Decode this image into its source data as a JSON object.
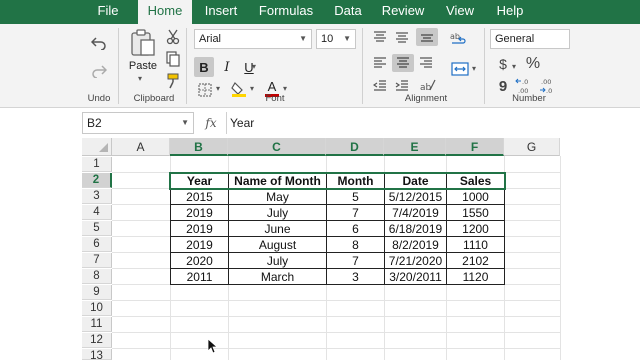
{
  "menu": {
    "tabs": [
      "File",
      "Home",
      "Insert",
      "Formulas",
      "Data",
      "Review",
      "View",
      "Help"
    ],
    "active": "Home"
  },
  "ribbon": {
    "undo_label": "Undo",
    "clipboard_label": "Clipboard",
    "paste_label": "Paste",
    "font_label": "Font",
    "font_name": "Arial",
    "font_size": "10",
    "bold": "B",
    "italic": "I",
    "underline": "U",
    "font_color_glyph": "A",
    "alignment_label": "Alignment",
    "number_label": "Number",
    "number_format": "General",
    "currency_symbol": "$",
    "percent_symbol": "%",
    "comma_symbol": "9",
    "decimal_increase": "←.0\n.00",
    "decimal_decrease": ".00\n→.0",
    "accent_color": "#217346",
    "font_color": "#c00000",
    "fill_color": "#ffd500"
  },
  "formula_bar": {
    "name_box": "B2",
    "fx": "fx",
    "content": "Year"
  },
  "grid": {
    "columns": [
      "A",
      "B",
      "C",
      "D",
      "E",
      "F",
      "G"
    ],
    "rows": [
      "1",
      "2",
      "3",
      "4",
      "5",
      "6",
      "7",
      "8",
      "9",
      "10",
      "11",
      "12",
      "13"
    ],
    "selected_columns": [
      "B",
      "C",
      "D",
      "E",
      "F"
    ],
    "selected_row": "2"
  },
  "table": {
    "headers": [
      "Year",
      "Name of Month",
      "Month",
      "Date",
      "Sales"
    ],
    "rows": [
      [
        "2015",
        "May",
        "5",
        "5/12/2015",
        "1000"
      ],
      [
        "2019",
        "July",
        "7",
        "7/4/2019",
        "1550"
      ],
      [
        "2019",
        "June",
        "6",
        "6/18/2019",
        "1200"
      ],
      [
        "2019",
        "August",
        "8",
        "8/2/2019",
        "1110"
      ],
      [
        "2020",
        "July",
        "7",
        "7/21/2020",
        "2102"
      ],
      [
        "2011",
        "March",
        "3",
        "3/20/2011",
        "1120"
      ]
    ]
  }
}
